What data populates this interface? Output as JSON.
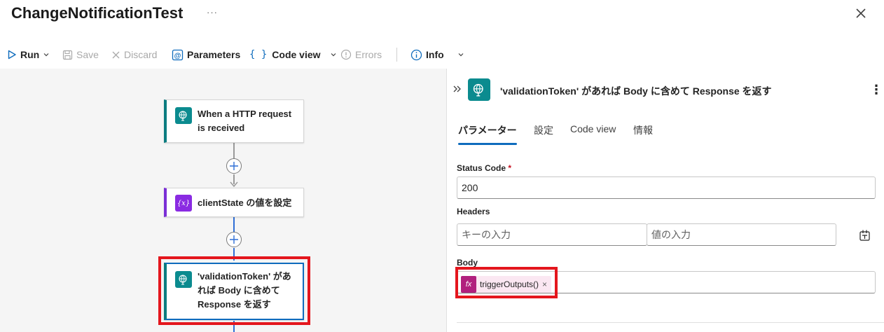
{
  "window": {
    "title": "ChangeNotificationTest",
    "more_label": "···"
  },
  "toolbar": {
    "run": "Run",
    "save": "Save",
    "discard": "Discard",
    "parameters": "Parameters",
    "code_view": "Code view",
    "errors": "Errors",
    "info": "Info"
  },
  "canvas": {
    "nodes": [
      {
        "label_line1": "When a HTTP request",
        "label_line2": "is received",
        "icon": "http-globe-icon",
        "color": "#0b8b8f"
      },
      {
        "label": "clientState の値を設定",
        "icon": "variable-icon",
        "color": "#8a2be2"
      },
      {
        "label_line1": "'validationToken' があ",
        "label_line2": "れば Body に含めて",
        "label_line3": "Response を返す",
        "icon": "http-globe-icon",
        "color": "#0b8b8f"
      }
    ]
  },
  "panel": {
    "title": "'validationToken' があれば Body に含めて Response を返す",
    "tabs": [
      "パラメーター",
      "設定",
      "Code view",
      "情報"
    ],
    "status_code": {
      "label": "Status Code",
      "required_mark": "*",
      "value": "200"
    },
    "headers": {
      "label": "Headers",
      "key_placeholder": "キーの入力",
      "value_placeholder": "値の入力"
    },
    "body": {
      "label": "Body",
      "token_label": "triggerOutputs()",
      "token_remove": "×",
      "fx_label": "fx"
    }
  },
  "colors": {
    "accent": "#0f6cbd",
    "highlight": "#e4161d",
    "http_teal": "#0b8b8f",
    "variable_purple": "#8a2be2",
    "expression_magenta": "#b1207e"
  }
}
